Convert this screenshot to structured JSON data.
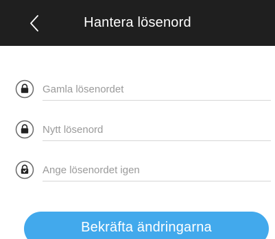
{
  "header": {
    "title": "Hantera lösenord",
    "back_icon": "chevron-left-icon",
    "background_color": "#1f1f1f"
  },
  "form": {
    "fields": [
      {
        "icon": "lock-icon",
        "placeholder": "Gamla lösenordet",
        "value": ""
      },
      {
        "icon": "lock-icon",
        "placeholder": "Nytt lösenord",
        "value": ""
      },
      {
        "icon": "lock-icon",
        "placeholder": "Ange lösenordet igen",
        "value": ""
      }
    ]
  },
  "confirm_button": {
    "label": "Bekräfta ändringarna",
    "color": "#42a9ec"
  }
}
